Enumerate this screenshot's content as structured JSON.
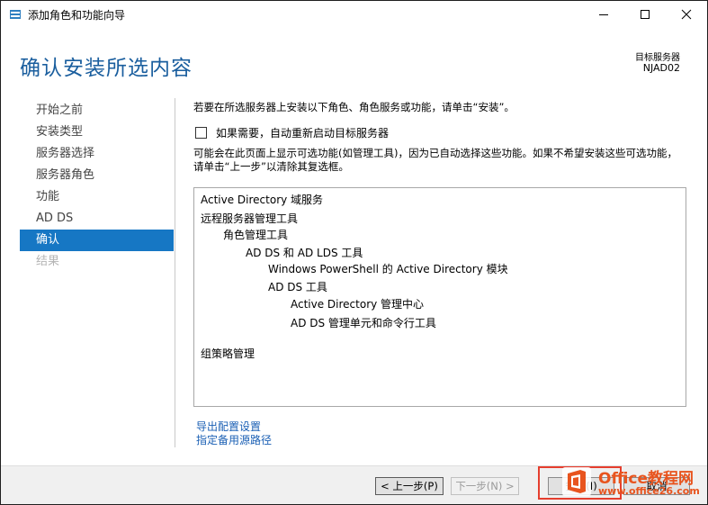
{
  "window": {
    "title": "添加角色和功能向导"
  },
  "header": {
    "page_title": "确认安装所选内容",
    "target_label": "目标服务器",
    "target_name": "NJAD02"
  },
  "nav": {
    "items": [
      {
        "label": "开始之前",
        "state": "normal"
      },
      {
        "label": "安装类型",
        "state": "normal"
      },
      {
        "label": "服务器选择",
        "state": "normal"
      },
      {
        "label": "服务器角色",
        "state": "normal"
      },
      {
        "label": "功能",
        "state": "normal"
      },
      {
        "label": "AD DS",
        "state": "normal"
      },
      {
        "label": "确认",
        "state": "active"
      },
      {
        "label": "结果",
        "state": "disabled"
      }
    ]
  },
  "content": {
    "intro": "若要在所选服务器上安装以下角色、角色服务或功能，请单击“安装”。",
    "restart_checkbox_label": "如果需要，自动重新启动目标服务器",
    "restart_checked": false,
    "note": "可能会在此页面上显示可选功能(如管理工具)，因为已自动选择这些功能。如果不希望安装这些可选功能，请单击“上一步”以清除其复选框。",
    "features": [
      "Active Directory 域服务",
      "远程服务器管理工具",
      "角色管理工具",
      "AD DS 和 AD LDS 工具",
      "Windows PowerShell 的 Active Directory 模块",
      "AD DS 工具",
      "Active Directory 管理中心",
      "AD DS 管理单元和命令行工具",
      "组策略管理"
    ],
    "links": {
      "export": "导出配置设置",
      "alt_source": "指定备用源路径"
    }
  },
  "footer": {
    "prev_label": "< 上一步(P)",
    "next_label": "下一步(N) >",
    "install_label": "安装(I)",
    "cancel_label": "取消"
  },
  "watermark": {
    "text": "Office教程网",
    "url": "www.office26.com"
  },
  "colors": {
    "title_blue": "#1a5e9e",
    "nav_active": "#1677c4",
    "link": "#1a5fb4",
    "highlight_border": "#e53e2e",
    "watermark": "#e8541e"
  }
}
